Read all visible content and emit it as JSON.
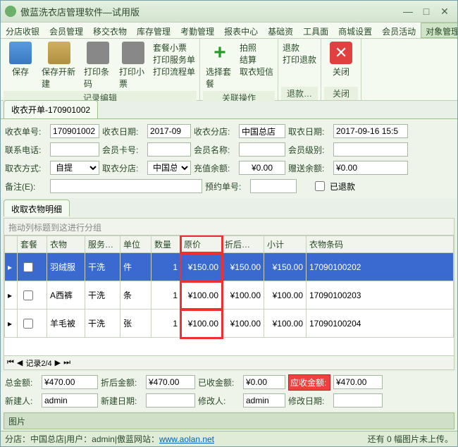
{
  "title": "傲蓝洗衣店管理软件—试用版",
  "menubar": [
    "分店收银",
    "会员管理",
    "移交衣物",
    "库存管理",
    "考勤管理",
    "报表中心",
    "基础资",
    "工具面",
    "商城设置",
    "会员活动",
    "对象管理"
  ],
  "ribbon": {
    "g1": {
      "save": "保存",
      "saveNew": "保存开新建",
      "printBar": "打印条码",
      "printSmall": "打印小票",
      "combo1": "套餐小票",
      "combo2": "打印服务单",
      "combo3": "打印流程单",
      "label": "记录编辑"
    },
    "g2": {
      "selCombo": "选择套餐",
      "photo": "拍照",
      "settle": "结算",
      "sms": "取衣短信",
      "label": "关联操作"
    },
    "g3": {
      "refund": "退款",
      "printRefund": "打印退款",
      "label": "退款…"
    },
    "g4": {
      "close": "关闭",
      "label": "关闭"
    }
  },
  "tab": "收衣开单-170901002",
  "form": {
    "l_orderNo": "收衣单号:",
    "orderNo": "170901002",
    "l_recvDate": "收衣日期:",
    "recvDate": "2017-09",
    "l_recvStore": "收衣分店:",
    "recvStore": "中国总店",
    "l_pickDate": "取衣日期:",
    "pickDate": "2017-09-16 15:5",
    "l_phone": "联系电话:",
    "phone": "",
    "l_cardNo": "会员卡号:",
    "cardNo": "",
    "l_memName": "会员名称:",
    "memName": "",
    "l_memLvl": "会员级别:",
    "memLvl": "",
    "l_pickWay": "取衣方式:",
    "pickWay": "自提",
    "l_pickStore": "取衣分店:",
    "pickStore": "中国总店",
    "l_topup": "充值余额:",
    "topup": "¥0.00",
    "l_bonus": "赠送余额:",
    "bonus": "¥0.00",
    "l_remark": "备注(E):",
    "remark": "",
    "l_resvNo": "预约单号:",
    "resvNo": "",
    "l_refunded": "已退款"
  },
  "subtab": "收取衣物明细",
  "grid": {
    "groupHint": "拖动列标题到这进行分组",
    "cols": [
      "套餐",
      "衣物",
      "服务…",
      "单位",
      "数量",
      "原价",
      "折后…",
      "小计",
      "衣物条码"
    ],
    "rows": [
      {
        "item": "羽绒服",
        "svc": "干洗",
        "unit": "件",
        "qty": "1",
        "orig": "¥150.00",
        "disc": "¥150.00",
        "sub": "¥150.00",
        "barcode": "17090100202",
        "sel": true
      },
      {
        "item": "A西裤",
        "svc": "干洗",
        "unit": "条",
        "qty": "1",
        "orig": "¥100.00",
        "disc": "¥100.00",
        "sub": "¥100.00",
        "barcode": "17090100203",
        "sel": false
      },
      {
        "item": "羊毛被",
        "svc": "干洗",
        "unit": "张",
        "qty": "1",
        "orig": "¥100.00",
        "disc": "¥100.00",
        "sub": "¥100.00",
        "barcode": "17090100204",
        "sel": false
      }
    ],
    "nav": "记录2/4"
  },
  "totals": {
    "l_total": "总金额:",
    "total": "¥470.00",
    "l_afterDisc": "折后金额:",
    "afterDisc": "¥470.00",
    "l_paid": "已收金额:",
    "paid": "¥0.00",
    "l_due": "应收金额:",
    "due": "¥470.00",
    "l_creator": "新建人:",
    "creator": "admin",
    "l_createDate": "新建日期:",
    "createDate": "",
    "l_modifier": "修改人:",
    "modifier": "admin",
    "l_modDate": "修改日期:",
    "modDate": ""
  },
  "picLabel": "图片",
  "status": {
    "store": "分店：中国总店",
    "sep": " | ",
    "user": "用户：admin",
    "site": "傲蓝网站：",
    "url": "www.aolan.net",
    "upload": "还有 0 幅图片未上传。"
  }
}
